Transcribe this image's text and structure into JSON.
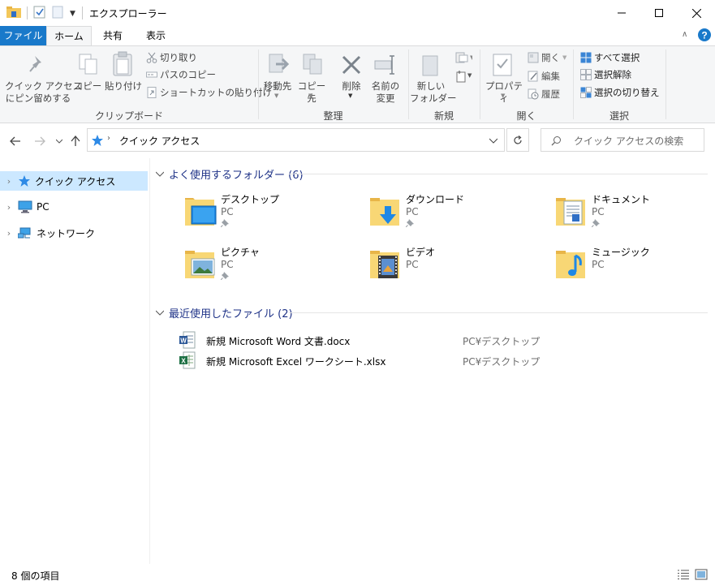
{
  "window": {
    "title": "エクスプローラー"
  },
  "tabs": {
    "file": "ファイル",
    "home": "ホーム",
    "share": "共有",
    "view": "表示"
  },
  "ribbon": {
    "clipboard": {
      "pin": "クイック アクセス\nにピン留めする",
      "copy": "コピー",
      "paste": "貼り付け",
      "cut": "切り取り",
      "copy_path": "パスのコピー",
      "paste_shortcut": "ショートカットの貼り付け",
      "group": "クリップボード"
    },
    "organize": {
      "move_to": "移動先",
      "copy_to": "コピー先",
      "delete": "削除",
      "rename": "名前の\n変更",
      "group": "整理"
    },
    "new": {
      "new_folder": "新しい\nフォルダー",
      "group": "新規"
    },
    "open": {
      "properties": "プロパティ",
      "open": "開く",
      "edit": "編集",
      "history": "履歴",
      "group": "開く"
    },
    "select": {
      "select_all": "すべて選択",
      "select_none": "選択解除",
      "invert": "選択の切り替え",
      "group": "選択"
    }
  },
  "address": {
    "path": "クイック アクセス",
    "search_placeholder": "クイック アクセスの検索"
  },
  "nav_pane": {
    "items": [
      "クイック アクセス",
      "PC",
      "ネットワーク"
    ]
  },
  "content": {
    "frequent_header": "よく使用するフォルダー (6)",
    "folders": [
      {
        "name": "デスクトップ",
        "location": "PC",
        "icon": "desktop-folder-icon",
        "pinned": true
      },
      {
        "name": "ダウンロード",
        "location": "PC",
        "icon": "downloads-folder-icon",
        "pinned": true
      },
      {
        "name": "ドキュメント",
        "location": "PC",
        "icon": "documents-folder-icon",
        "pinned": true
      },
      {
        "name": "ピクチャ",
        "location": "PC",
        "icon": "pictures-folder-icon",
        "pinned": true
      },
      {
        "name": "ビデオ",
        "location": "PC",
        "icon": "videos-folder-icon",
        "pinned": false
      },
      {
        "name": "ミュージック",
        "location": "PC",
        "icon": "music-folder-icon",
        "pinned": false
      }
    ],
    "recent_header": "最近使用したファイル (2)",
    "recent_files": [
      {
        "name": "新規 Microsoft Word 文書.docx",
        "path": "PC¥デスクトップ",
        "icon": "word-file-icon"
      },
      {
        "name": "新規 Microsoft Excel ワークシート.xlsx",
        "path": "PC¥デスクトップ",
        "icon": "excel-file-icon"
      }
    ]
  },
  "status": {
    "item_count": "8 個の項目"
  },
  "colors": {
    "accent": "#1979ca",
    "selection": "#cce8ff",
    "group_header": "#1e3287",
    "folder": "#f8d775"
  }
}
